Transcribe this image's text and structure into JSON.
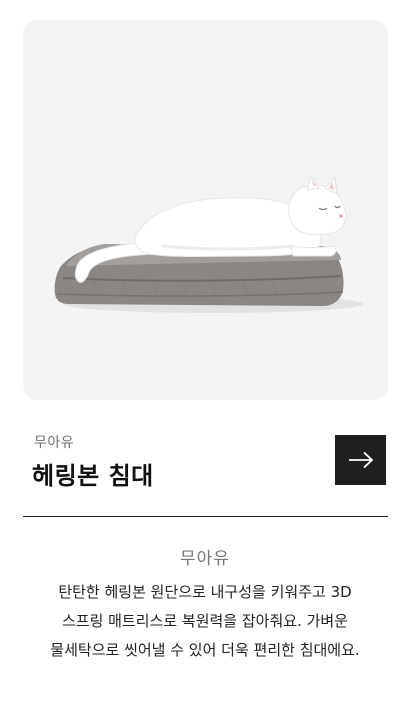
{
  "product": {
    "brand": "무아유",
    "name": "헤링본 침대",
    "image_alt": "헤링본 침대 위의 흰 고양이",
    "background_color": "#f4f4f4"
  },
  "actions": {
    "arrow_icon": "arrow-right-icon"
  },
  "description": {
    "brand": "무아유",
    "lines": [
      "탄탄한 헤링본 원단으로 내구성을 키워주고 3D",
      "스프링 매트리스로 복원력을 잡아줘요. 가벼운",
      "물세탁으로 씻어낼 수 있어 더욱 편리한 침대에요."
    ]
  },
  "colors": {
    "button_bg": "#1f1f1f",
    "bed_gray": "#8a8683",
    "cat_white": "#ffffff"
  }
}
